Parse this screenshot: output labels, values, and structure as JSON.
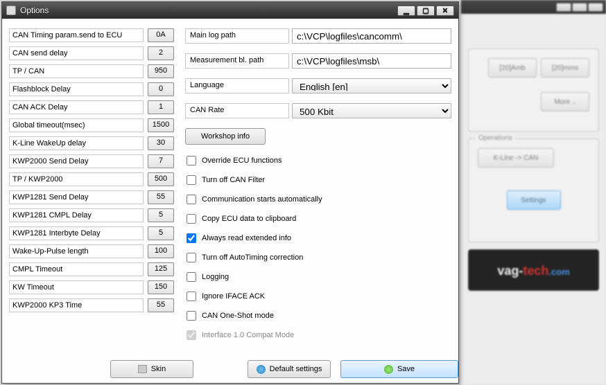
{
  "window": {
    "title": "Options"
  },
  "params": [
    {
      "label": "CAN Timing param.send to ECU",
      "value": "0A"
    },
    {
      "label": "CAN send delay",
      "value": "2"
    },
    {
      "label": "TP / CAN",
      "value": "950"
    },
    {
      "label": "Flashblock Delay",
      "value": "0"
    },
    {
      "label": "CAN ACK Delay",
      "value": "1"
    },
    {
      "label": "Global timeout(msec)",
      "value": "1500"
    },
    {
      "label": "K-Line WakeUp delay",
      "value": "30"
    },
    {
      "label": "KWP2000 Send Delay",
      "value": "7"
    },
    {
      "label": "TP / KWP2000",
      "value": "500"
    },
    {
      "label": "KWP1281 Send Delay",
      "value": "55"
    },
    {
      "label": "KWP1281 CMPL Delay",
      "value": "5"
    },
    {
      "label": "KWP1281 Interbyte Delay",
      "value": "5"
    },
    {
      "label": "Wake-Up-Pulse length",
      "value": "100"
    },
    {
      "label": "CMPL Timeout",
      "value": "125"
    },
    {
      "label": "KW Timeout",
      "value": "150"
    },
    {
      "label": "KWP2000 KP3 Time",
      "value": "55"
    }
  ],
  "paths": {
    "main_log_label": "Main log path",
    "main_log_value": "c:\\VCP\\logfiles\\cancomm\\",
    "msb_label": "Measurement bl. path",
    "msb_value": "c:\\VCP\\logfiles\\msb\\"
  },
  "language": {
    "label": "Language",
    "value": "English [en]"
  },
  "can_rate": {
    "label": "CAN Rate",
    "value": "500 Kbit"
  },
  "buttons": {
    "workshop": "Workshop info",
    "skin": "Skin",
    "defaults": "Default settings",
    "save": "Save"
  },
  "checks": [
    {
      "label": "Override ECU functions",
      "checked": false,
      "disabled": false
    },
    {
      "label": "Turn off CAN Filter",
      "checked": false,
      "disabled": false
    },
    {
      "label": "Communication starts automatically",
      "checked": false,
      "disabled": false
    },
    {
      "label": "Copy ECU data to clipboard",
      "checked": false,
      "disabled": false
    },
    {
      "label": "Always read extended info",
      "checked": true,
      "disabled": false
    },
    {
      "label": "Turn off AutoTiming correction",
      "checked": false,
      "disabled": false
    },
    {
      "label": "Logging",
      "checked": false,
      "disabled": false
    },
    {
      "label": "Ignore IFACE ACK",
      "checked": false,
      "disabled": false
    },
    {
      "label": "CAN One-Shot mode",
      "checked": false,
      "disabled": false
    },
    {
      "label": "Interface 1.0 Compat Mode",
      "checked": true,
      "disabled": true
    }
  ],
  "bg": {
    "slot_buttons": [
      "[20]Amb",
      "[20]mms"
    ],
    "more": "More ..",
    "ops_title": "Operations",
    "diag_mode": "K-Line -> CAN",
    "settings": "Settings",
    "logo_a": "vag-",
    "logo_b": "tech",
    "logo_c": ".com"
  }
}
